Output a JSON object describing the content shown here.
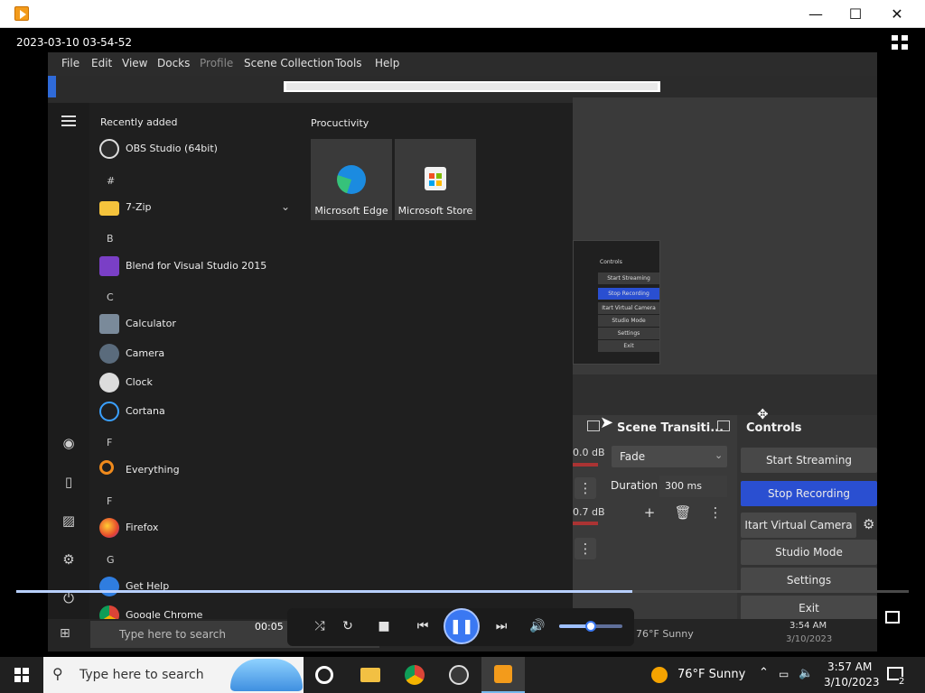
{
  "window": {
    "minimize": "—",
    "maximize": "☐",
    "close": "✕"
  },
  "video": {
    "timestamp": "2023-03-10 03-54-52",
    "elapsed": "00:05"
  },
  "obs_menu": [
    "File",
    "Edit",
    "View",
    "Docks",
    "Profile",
    "Scene Collection",
    "Tools",
    "Help"
  ],
  "start_menu": {
    "recently_added": "Recently added",
    "productivity": "Procuctivity",
    "items": [
      {
        "label": "OBS Studio (64bit)"
      },
      {
        "letter": "#"
      },
      {
        "label": "7-Zip"
      },
      {
        "letter": "B"
      },
      {
        "label": "Blend for Visual Studio 2015"
      },
      {
        "letter": "C"
      },
      {
        "label": "Calculator"
      },
      {
        "label": "Camera"
      },
      {
        "label": "Clock"
      },
      {
        "label": "Cortana"
      },
      {
        "letter": "F"
      },
      {
        "label": "Everything"
      },
      {
        "letter": "F"
      },
      {
        "label": "Firefox"
      },
      {
        "letter": "G"
      },
      {
        "label": "Get Help"
      },
      {
        "label": "Google Chrome"
      }
    ],
    "tiles": [
      {
        "label": "Microsoft Edge"
      },
      {
        "label": "Microsoft Store"
      }
    ]
  },
  "mini_obs": {
    "title": "Controls",
    "buttons": [
      "Start Streaming",
      "Stop Recording",
      "Itart Virtual Camera",
      "Studio Mode",
      "Settings",
      "Exit"
    ]
  },
  "obs": {
    "scene_transitions": "Scene Transiti...",
    "controls": "Controls",
    "transition": "Fade",
    "duration_label": "Duration",
    "duration_value": "300 ms",
    "db1": "0.0 dB",
    "db2": "0.7 dB",
    "buttons": {
      "start_streaming": "Start Streaming",
      "stop_recording": "Stop Recording",
      "virtual_camera": "Itart Virtual Camera",
      "studio_mode": "Studio Mode",
      "settings": "Settings",
      "exit": "Exit"
    }
  },
  "inner_taskbar": {
    "search": "Type here to search",
    "weather": "76°F  Sunny",
    "time": "3:54 AM",
    "date": "3/10/2023"
  },
  "taskbar": {
    "search_placeholder": "Type here to search",
    "weather": "76°F  Sunny",
    "time": "3:57 AM",
    "date": "3/10/2023",
    "notifications": "2"
  },
  "player": {
    "volume": 0.5,
    "progress": 0.69
  }
}
